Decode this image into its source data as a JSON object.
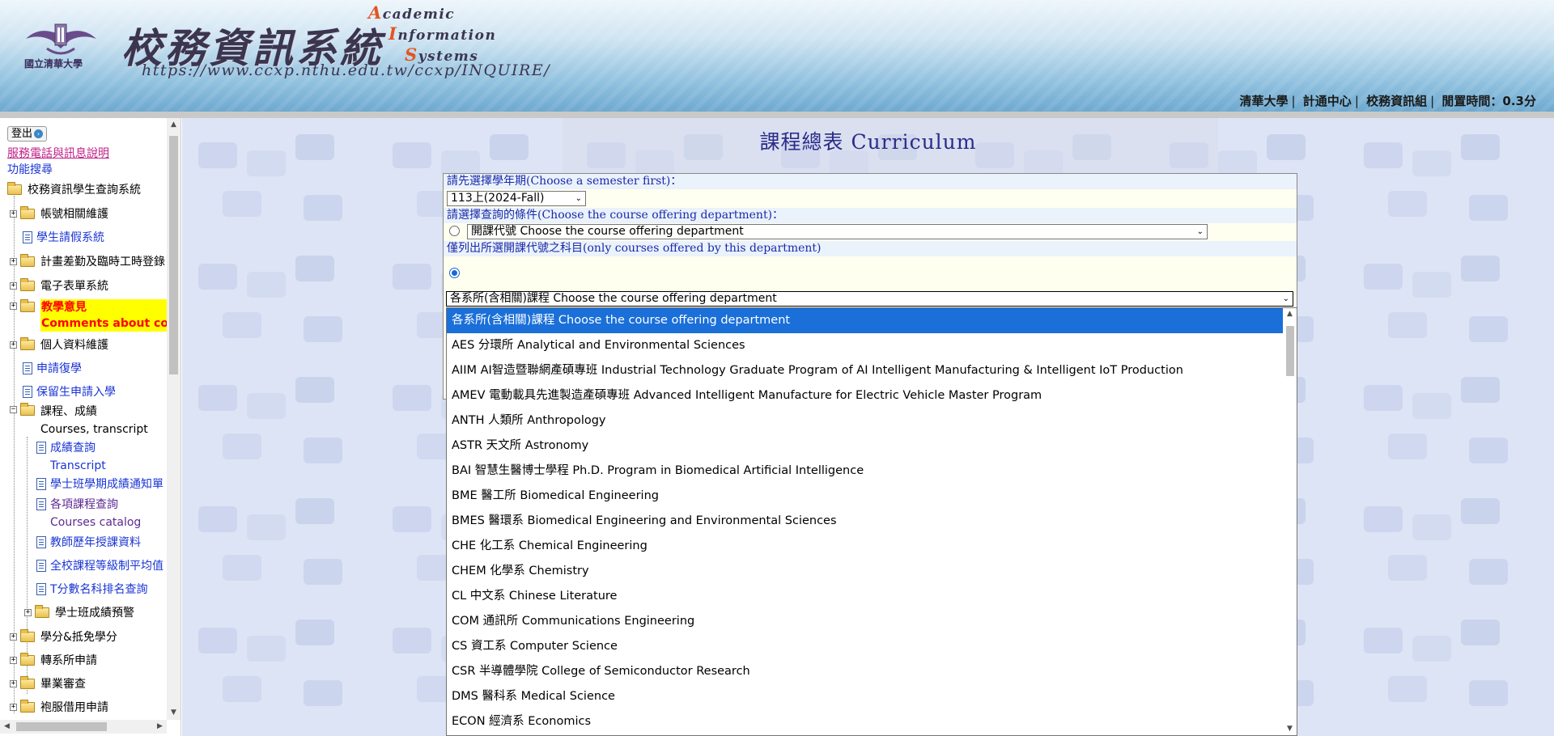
{
  "header": {
    "university_name": "國立清華大學",
    "system_title": "校務資訊系統",
    "system_en_lines": [
      {
        "cap": "A",
        "rest": "cademic"
      },
      {
        "cap": "I",
        "rest": "nformation"
      },
      {
        "cap": "S",
        "rest": "ystems"
      }
    ],
    "system_url": "https://www.ccxp.nthu.edu.tw/ccxp/INQUIRE/",
    "top_links": [
      "清華大學",
      "計通中心",
      "校務資訊組"
    ],
    "idle_time_label": "閒置時間：0.3分",
    "accent_color": "#e2561f"
  },
  "sidebar": {
    "logout_label": "登出",
    "service_info_link": "服務電話與訊息說明",
    "search_link": "功能搜尋",
    "root_label": "校務資訊學生查詢系統",
    "items": [
      {
        "label": "帳號相關維護",
        "type": "folder"
      },
      {
        "label": "學生請假系統",
        "type": "doc"
      },
      {
        "label": "計畫差勤及臨時工時登錄",
        "type": "folder"
      },
      {
        "label": "電子表單系統",
        "type": "folder"
      },
      {
        "label": "教學意見",
        "label2": "Comments about courses",
        "type": "folder"
      },
      {
        "label": "個人資料維護",
        "type": "folder"
      },
      {
        "label": "申請復學",
        "type": "doc"
      },
      {
        "label": "保留生申請入學",
        "type": "doc"
      },
      {
        "label": "課程、成績",
        "label2": "Courses, transcript",
        "type": "folder-open"
      },
      {
        "label": "成績查詢",
        "label2": "Transcript",
        "type": "doc"
      },
      {
        "label": "學士班學期成績通知單",
        "type": "doc"
      },
      {
        "label": "各項課程查詢",
        "label2": "Courses catalog",
        "type": "doc"
      },
      {
        "label": "教師歷年授課資料",
        "type": "doc"
      },
      {
        "label": "全校課程等級制平均值",
        "type": "doc"
      },
      {
        "label": "T分數名科排名查詢",
        "type": "doc"
      },
      {
        "label": "學士班成績預警",
        "type": "folder"
      },
      {
        "label": "學分&抵免學分",
        "type": "folder"
      },
      {
        "label": "轉系所申請",
        "type": "folder"
      },
      {
        "label": "畢業審查",
        "type": "folder"
      },
      {
        "label": "袍服借用申請",
        "type": "folder"
      }
    ]
  },
  "main": {
    "title": "課程總表 Curriculum",
    "semester_prompt": "請先選擇學年期(Choose a semester first)：",
    "semester_value": "113上(2024-Fall)",
    "condition_prompt": "請選擇查詢的條件(Choose the course offering department)：",
    "dept_code_select": "開課代號 Choose the course offering department",
    "only_dept_note": "僅列出所選開課代號之科目(only courses offered by this department)",
    "all_dept_select": "各系所(含相關)課程 Choose the course offering department"
  },
  "dropdown": {
    "options": [
      "各系所(含相關)課程 Choose the course offering department",
      "AES 分環所 Analytical and Environmental Sciences",
      "AIIM AI智造暨聯網產碩專班 Industrial Technology Graduate Program of AI Intelligent Manufacturing & Intelligent IoT Production",
      "AMEV 電動載具先進製造產碩專班 Advanced Intelligent Manufacture for Electric Vehicle Master Program",
      "ANTH 人類所 Anthropology",
      "ASTR 天文所 Astronomy",
      "BAI 智慧生醫博士學程 Ph.D. Program in Biomedical Artificial Intelligence",
      "BME 醫工所 Biomedical Engineering",
      "BMES 醫環系 Biomedical Engineering and Environmental Sciences",
      "CHE 化工系 Chemical Engineering",
      "CHEM 化學系 Chemistry",
      "CL 中文系 Chinese Literature",
      "COM 通訊所 Communications Engineering",
      "CS 資工系 Computer Science",
      "CSR 半導體學院 College of Semiconductor Research",
      "DMS 醫科系 Medical Science",
      "ECON 經濟系 Economics"
    ],
    "selected_index": 0,
    "highlight_color": "#1a6fd9"
  }
}
